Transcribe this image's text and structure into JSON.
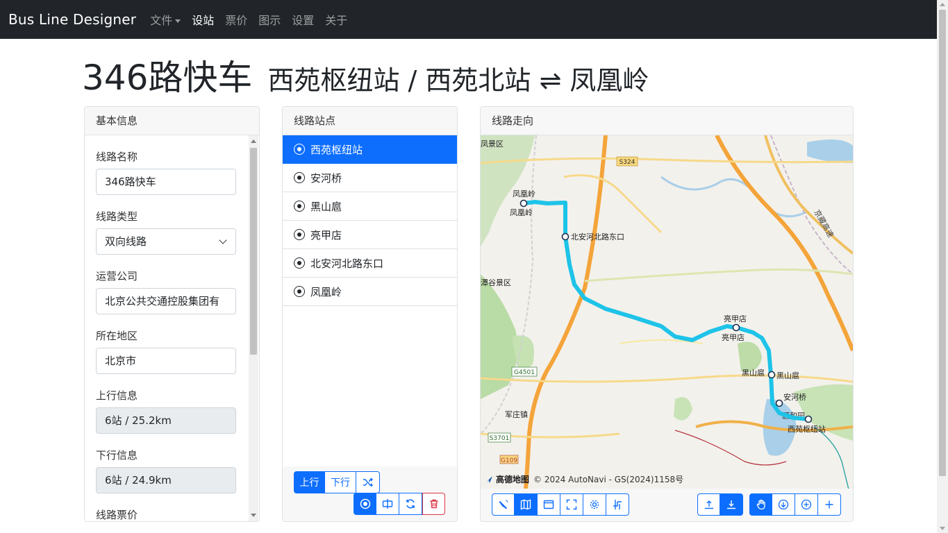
{
  "navbar": {
    "brand": "Bus Line Designer",
    "items": [
      {
        "label": "文件",
        "dropdown": true,
        "active": false
      },
      {
        "label": "设站",
        "active": true
      },
      {
        "label": "票价",
        "active": false
      },
      {
        "label": "图示",
        "active": false
      },
      {
        "label": "设置",
        "active": false
      },
      {
        "label": "关于",
        "active": false
      }
    ]
  },
  "title": {
    "route": "346路快车",
    "terminals": "西苑枢纽站 / 西苑北站 ⇌ 凤凰岭"
  },
  "basic_info": {
    "header": "基本信息",
    "fields": [
      {
        "label": "线路名称",
        "value": "346路快车",
        "type": "text"
      },
      {
        "label": "线路类型",
        "value": "双向线路",
        "type": "select"
      },
      {
        "label": "运营公司",
        "value": "北京公共交通控股集团有",
        "type": "text"
      },
      {
        "label": "所在地区",
        "value": "北京市",
        "type": "text"
      },
      {
        "label": "上行信息",
        "value": "6站 / 25.2km",
        "type": "readonly"
      },
      {
        "label": "下行信息",
        "value": "6站 / 24.9km",
        "type": "readonly"
      },
      {
        "label": "线路票价",
        "value": "",
        "type": "text"
      }
    ]
  },
  "stations": {
    "header": "线路站点",
    "items": [
      "西苑枢纽站",
      "安河桥",
      "黑山扈",
      "亮甲店",
      "北安河北路东口",
      "凤凰岭"
    ],
    "selected_index": 0,
    "direction_buttons": [
      "上行",
      "下行"
    ],
    "active_direction": "上行",
    "action_icons": [
      "station-mode-icon",
      "split-icon",
      "refresh-icon",
      "delete-icon"
    ]
  },
  "map": {
    "header": "线路走向",
    "attribution_logo": "高德地图",
    "attribution_text": "© 2024 AutoNavi - GS(2024)1158号",
    "route_color": "#1ec3e8",
    "area_labels": [
      "凤凰岭",
      "凤凰岭",
      "北安河北路东口",
      "亮甲店",
      "亮甲店",
      "黑山扈",
      "黑山扈",
      "安河桥",
      "西苑枢纽站",
      "颐和园",
      "军庄镇",
      "潭谷景区",
      "凤景区"
    ],
    "road_labels": [
      "S324",
      "G4501",
      "S3701",
      "G109",
      "京藏高速"
    ],
    "toolbar_left": [
      "satellite-icon",
      "map-layer-icon",
      "window-icon",
      "fullscreen-icon",
      "settings-icon",
      "route-icon"
    ],
    "toolbar_mid": [
      "upload-icon",
      "download-icon"
    ],
    "toolbar_right": [
      "pan-hand-icon",
      "move-down-icon",
      "add-circle-icon",
      "add-icon"
    ]
  }
}
